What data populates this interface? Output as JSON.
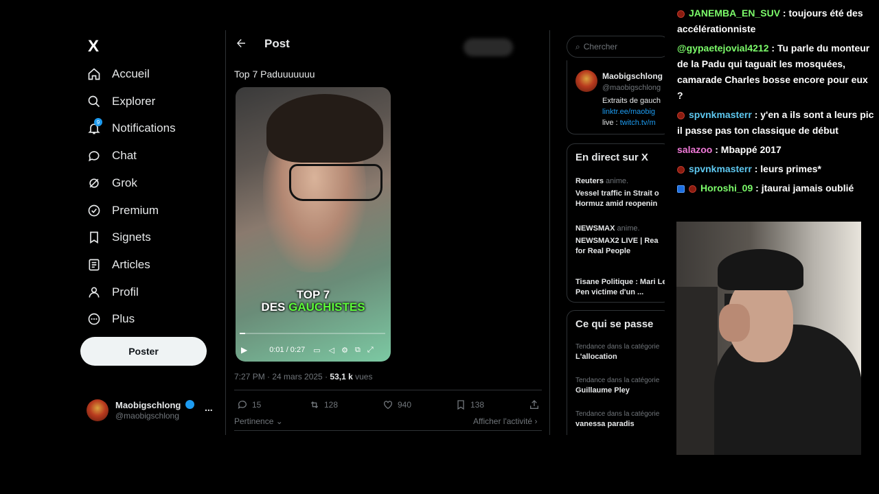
{
  "sidebar": {
    "logo": "X",
    "items": [
      {
        "label": "Accueil",
        "icon": "home-icon"
      },
      {
        "label": "Explorer",
        "icon": "search-icon"
      },
      {
        "label": "Notifications",
        "icon": "bell-icon",
        "badge": "9"
      },
      {
        "label": "Chat",
        "icon": "chat-icon"
      },
      {
        "label": "Grok",
        "icon": "grok-icon"
      },
      {
        "label": "Premium",
        "icon": "premium-icon"
      },
      {
        "label": "Signets",
        "icon": "bookmark-icon"
      },
      {
        "label": "Articles",
        "icon": "articles-icon"
      },
      {
        "label": "Profil",
        "icon": "profile-icon"
      },
      {
        "label": "Plus",
        "icon": "more-icon"
      }
    ],
    "post_button": "Poster",
    "account": {
      "name": "Maobigschlong",
      "handle": "@maobigschlong",
      "menu": "..."
    }
  },
  "post": {
    "header": "Post",
    "text": "Top 7 Paduuuuuuu",
    "video": {
      "caption_line1": "TOP 7",
      "caption_line2_a": "DES ",
      "caption_line2_b": "GAUCHISTES",
      "time": "0:01 / 0:27",
      "progress": 0.04
    },
    "meta": {
      "time": "7:27 PM · 24 mars 2025 · ",
      "views": "53,1 k",
      "views_label": " vues"
    },
    "actions": {
      "replies": "15",
      "reposts": "128",
      "likes": "940",
      "bookmarks": "138"
    },
    "sort": "Pertinence",
    "activity": "Afficher l'activité"
  },
  "right": {
    "search_placeholder": "Chercher",
    "profile": {
      "name": "Maobigschlong",
      "handle": "@maobigschlong",
      "bio1": "Extraits de gauch",
      "link1": "linktr.ee/maobig",
      "live_label": "live : ",
      "link2": "twitch.tv/m"
    },
    "live": {
      "title": "En direct sur X",
      "items": [
        {
          "source": "Reuters",
          "status": "anime.",
          "text": "Vessel traffic in Strait o Hormuz amid reopenin"
        },
        {
          "source": "NEWSMAX",
          "status": "anime.",
          "text": "NEWSMAX2 LIVE | Rea for Real People"
        },
        {
          "source": "",
          "status": "",
          "text": "Tisane Politique : Mari Le Pen victime d'un ..."
        }
      ]
    },
    "trends": {
      "title": "Ce qui se passe",
      "items": [
        {
          "category": "Tendance dans la catégorie",
          "name": "L'allocation"
        },
        {
          "category": "Tendance dans la catégorie",
          "name": "Guillaume Pley"
        },
        {
          "category": "Tendance dans la catégorie",
          "name": "vanessa paradis"
        }
      ]
    }
  },
  "chat": [
    {
      "user": "JANEMBA_EN_SUV",
      "color": "#7cfc6a",
      "badges": 1,
      "text": " : toujours été des accélérationniste"
    },
    {
      "user": "@gypaetejovial4212",
      "color": "#7cfc6a",
      "badges": 0,
      "text": " : Tu parle du monteur de la Padu qui taguait les mosquées, camarade Charles bosse encore pour eux ?"
    },
    {
      "user": "spvnkmasterr",
      "color": "#5ec8f0",
      "badges": 1,
      "text": " : y'en a ils sont a leurs pic il passe pas ton classique de début"
    },
    {
      "user": "salazoo",
      "color": "#f07ad8",
      "badges": 0,
      "text": " : Mbappé 2017"
    },
    {
      "user": "spvnkmasterr",
      "color": "#5ec8f0",
      "badges": 1,
      "text": " : leurs primes*"
    },
    {
      "user": "Horoshi_09",
      "color": "#7cfc6a",
      "badges": 2,
      "text": " : jtaurai jamais oublié"
    }
  ]
}
